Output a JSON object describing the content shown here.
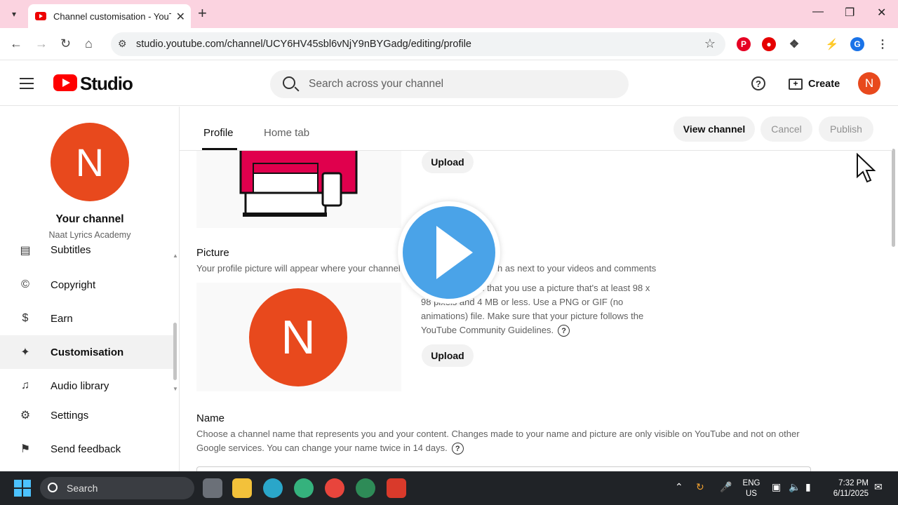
{
  "browser": {
    "tab_title": "Channel customisation - YouTube Studio",
    "url": "studio.youtube.com/channel/UCY6HV45sbl6vNjY9nBYGadg/editing/profile",
    "profile_initial": "G"
  },
  "header": {
    "logo_text": "Studio",
    "search_placeholder": "Search across your channel",
    "create_label": "Create",
    "avatar_initial": "N"
  },
  "sidebar": {
    "avatar_initial": "N",
    "your_channel": "Your channel",
    "channel_name": "Naat Lyrics Academy",
    "items": [
      {
        "label": "Subtitles",
        "icon": "subtitles-icon"
      },
      {
        "label": "Copyright",
        "icon": "copyright-icon"
      },
      {
        "label": "Earn",
        "icon": "dollar-icon"
      },
      {
        "label": "Customisation",
        "icon": "magic-wand-icon",
        "active": true
      },
      {
        "label": "Audio library",
        "icon": "music-note-icon"
      },
      {
        "label": "Settings",
        "icon": "gear-icon"
      },
      {
        "label": "Send feedback",
        "icon": "feedback-icon"
      }
    ]
  },
  "main": {
    "tabs": [
      "Profile",
      "Home tab"
    ],
    "actions": {
      "view_channel": "View channel",
      "cancel": "Cancel",
      "publish": "Publish"
    },
    "banner_upload": "Upload",
    "picture": {
      "title": "Picture",
      "desc_left": "Your profile picture will appear where your channel",
      "desc_right": "e, such as next to your videos and comments",
      "avatar_initial": "N",
      "recommend": "ed that you use a picture that's at least 98 x 98 pixels and 4 MB or less. Use a PNG or GIF (no animations) file. Make sure that your picture follows the YouTube Community Guidelines.",
      "upload": "Upload"
    },
    "name": {
      "title": "Name",
      "desc": "Choose a channel name that represents you and your content. Changes made to your name and picture are only visible on YouTube and not on other Google services. You can change your name twice in 14 days."
    }
  },
  "taskbar": {
    "search": "Search",
    "lang1": "ENG",
    "lang2": "US",
    "time": "7:32 PM",
    "date": "6/11/2025"
  }
}
